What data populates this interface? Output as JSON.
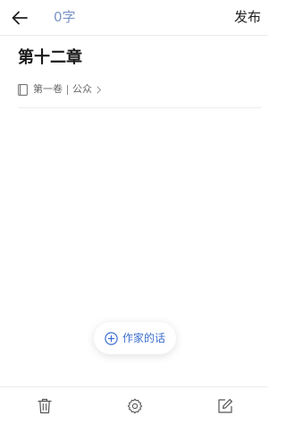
{
  "header": {
    "word_count": "0字",
    "publish_label": "发布"
  },
  "chapter": {
    "title": "第十二章",
    "volume": "第一卷",
    "category": "公众"
  },
  "author_note": {
    "label": "作家的话"
  },
  "colors": {
    "accent": "#3d6fd0",
    "word_count": "#7a93c4",
    "divider": "#ececec"
  },
  "icons": {
    "back": "arrow-left-icon",
    "book": "book-icon",
    "chevron": "chevron-right-icon",
    "plus": "plus-circle-icon",
    "trash": "trash-icon",
    "settings": "gear-icon",
    "edit": "edit-icon"
  }
}
